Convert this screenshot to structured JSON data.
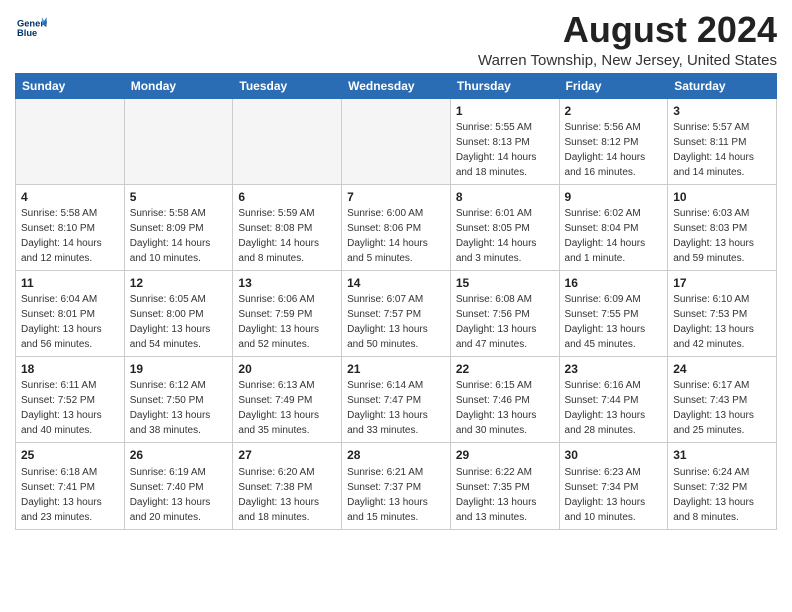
{
  "header": {
    "title": "August 2024",
    "location": "Warren Township, New Jersey, United States",
    "logo_line1": "General",
    "logo_line2": "Blue"
  },
  "days_of_week": [
    "Sunday",
    "Monday",
    "Tuesday",
    "Wednesday",
    "Thursday",
    "Friday",
    "Saturday"
  ],
  "weeks": [
    [
      {
        "day": "",
        "info": ""
      },
      {
        "day": "",
        "info": ""
      },
      {
        "day": "",
        "info": ""
      },
      {
        "day": "",
        "info": ""
      },
      {
        "day": "1",
        "info": "Sunrise: 5:55 AM\nSunset: 8:13 PM\nDaylight: 14 hours\nand 18 minutes."
      },
      {
        "day": "2",
        "info": "Sunrise: 5:56 AM\nSunset: 8:12 PM\nDaylight: 14 hours\nand 16 minutes."
      },
      {
        "day": "3",
        "info": "Sunrise: 5:57 AM\nSunset: 8:11 PM\nDaylight: 14 hours\nand 14 minutes."
      }
    ],
    [
      {
        "day": "4",
        "info": "Sunrise: 5:58 AM\nSunset: 8:10 PM\nDaylight: 14 hours\nand 12 minutes."
      },
      {
        "day": "5",
        "info": "Sunrise: 5:58 AM\nSunset: 8:09 PM\nDaylight: 14 hours\nand 10 minutes."
      },
      {
        "day": "6",
        "info": "Sunrise: 5:59 AM\nSunset: 8:08 PM\nDaylight: 14 hours\nand 8 minutes."
      },
      {
        "day": "7",
        "info": "Sunrise: 6:00 AM\nSunset: 8:06 PM\nDaylight: 14 hours\nand 5 minutes."
      },
      {
        "day": "8",
        "info": "Sunrise: 6:01 AM\nSunset: 8:05 PM\nDaylight: 14 hours\nand 3 minutes."
      },
      {
        "day": "9",
        "info": "Sunrise: 6:02 AM\nSunset: 8:04 PM\nDaylight: 14 hours\nand 1 minute."
      },
      {
        "day": "10",
        "info": "Sunrise: 6:03 AM\nSunset: 8:03 PM\nDaylight: 13 hours\nand 59 minutes."
      }
    ],
    [
      {
        "day": "11",
        "info": "Sunrise: 6:04 AM\nSunset: 8:01 PM\nDaylight: 13 hours\nand 56 minutes."
      },
      {
        "day": "12",
        "info": "Sunrise: 6:05 AM\nSunset: 8:00 PM\nDaylight: 13 hours\nand 54 minutes."
      },
      {
        "day": "13",
        "info": "Sunrise: 6:06 AM\nSunset: 7:59 PM\nDaylight: 13 hours\nand 52 minutes."
      },
      {
        "day": "14",
        "info": "Sunrise: 6:07 AM\nSunset: 7:57 PM\nDaylight: 13 hours\nand 50 minutes."
      },
      {
        "day": "15",
        "info": "Sunrise: 6:08 AM\nSunset: 7:56 PM\nDaylight: 13 hours\nand 47 minutes."
      },
      {
        "day": "16",
        "info": "Sunrise: 6:09 AM\nSunset: 7:55 PM\nDaylight: 13 hours\nand 45 minutes."
      },
      {
        "day": "17",
        "info": "Sunrise: 6:10 AM\nSunset: 7:53 PM\nDaylight: 13 hours\nand 42 minutes."
      }
    ],
    [
      {
        "day": "18",
        "info": "Sunrise: 6:11 AM\nSunset: 7:52 PM\nDaylight: 13 hours\nand 40 minutes."
      },
      {
        "day": "19",
        "info": "Sunrise: 6:12 AM\nSunset: 7:50 PM\nDaylight: 13 hours\nand 38 minutes."
      },
      {
        "day": "20",
        "info": "Sunrise: 6:13 AM\nSunset: 7:49 PM\nDaylight: 13 hours\nand 35 minutes."
      },
      {
        "day": "21",
        "info": "Sunrise: 6:14 AM\nSunset: 7:47 PM\nDaylight: 13 hours\nand 33 minutes."
      },
      {
        "day": "22",
        "info": "Sunrise: 6:15 AM\nSunset: 7:46 PM\nDaylight: 13 hours\nand 30 minutes."
      },
      {
        "day": "23",
        "info": "Sunrise: 6:16 AM\nSunset: 7:44 PM\nDaylight: 13 hours\nand 28 minutes."
      },
      {
        "day": "24",
        "info": "Sunrise: 6:17 AM\nSunset: 7:43 PM\nDaylight: 13 hours\nand 25 minutes."
      }
    ],
    [
      {
        "day": "25",
        "info": "Sunrise: 6:18 AM\nSunset: 7:41 PM\nDaylight: 13 hours\nand 23 minutes."
      },
      {
        "day": "26",
        "info": "Sunrise: 6:19 AM\nSunset: 7:40 PM\nDaylight: 13 hours\nand 20 minutes."
      },
      {
        "day": "27",
        "info": "Sunrise: 6:20 AM\nSunset: 7:38 PM\nDaylight: 13 hours\nand 18 minutes."
      },
      {
        "day": "28",
        "info": "Sunrise: 6:21 AM\nSunset: 7:37 PM\nDaylight: 13 hours\nand 15 minutes."
      },
      {
        "day": "29",
        "info": "Sunrise: 6:22 AM\nSunset: 7:35 PM\nDaylight: 13 hours\nand 13 minutes."
      },
      {
        "day": "30",
        "info": "Sunrise: 6:23 AM\nSunset: 7:34 PM\nDaylight: 13 hours\nand 10 minutes."
      },
      {
        "day": "31",
        "info": "Sunrise: 6:24 AM\nSunset: 7:32 PM\nDaylight: 13 hours\nand 8 minutes."
      }
    ]
  ]
}
